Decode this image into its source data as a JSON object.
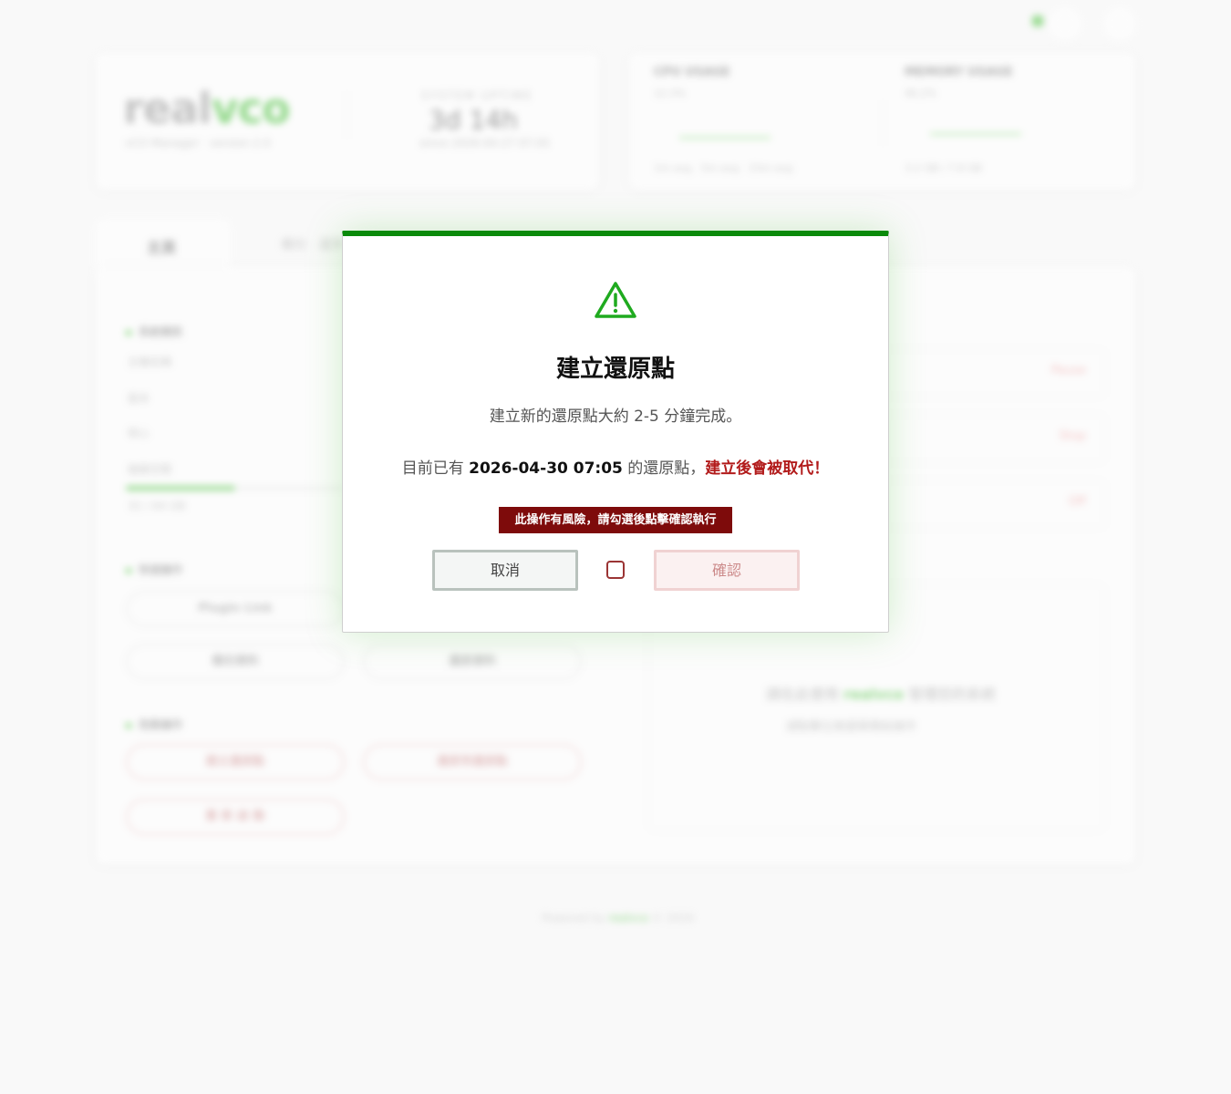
{
  "background": {
    "logo_part1": "real",
    "logo_part2": "vco",
    "logo_subtitle": "vCO Manager · version 2.0",
    "uptime_label": "SYSTEM UPTIME",
    "uptime_value": "3d 14h",
    "uptime_sub": "since 2026-04-27 07:05",
    "stat1_title": "CPU USAGE",
    "stat1_sub": "12.3%",
    "stat1_foot": "1m avg · 5m avg · 15m avg",
    "stat2_title": "MEMORY USAGE",
    "stat2_sub": "46.2%",
    "stat2_foot": "3.2 GB / 7.8 GB",
    "tab_active": "主頁",
    "tab_other": "備份 · 還原",
    "section1": "系統資訊",
    "kv1": "主機名稱",
    "kv2": "版本",
    "kv3": "核心",
    "kv4": "磁碟空間",
    "kv5": "32 / 64 GB",
    "section2": "快速操作",
    "pill1": "Plugin Link",
    "pill2": "備份資料",
    "pill3": "還原資料",
    "section3": "危險操作",
    "pill4": "建立還原點",
    "pill5": "還原到還原點",
    "pill6": "重 新 啟 動",
    "row1": "Pause",
    "row2": "Stop",
    "row3": "Off",
    "inner_text_pre": "請在此使用",
    "inner_text_brand": "realvco",
    "inner_text_post": "管理您的系統",
    "inner_sub": "請點擊左側選單開始操作",
    "footer_pre": "Powered by",
    "footer_brand": "realvco",
    "footer_post": "© 2026"
  },
  "modal": {
    "icon": "warning-triangle-icon",
    "title": "建立還原點",
    "description": "建立新的還原點大約 2-5 分鐘完成。",
    "existing_prefix": "目前已有",
    "existing_date": "2026-04-30 07:05",
    "existing_suffix": "的還原點，",
    "existing_warning": "建立後會被取代！",
    "risk_notice": "此操作有風險，請勾選後點擊確認執行",
    "cancel_label": "取消",
    "confirm_label": "確認",
    "confirm_checked": false
  },
  "colors": {
    "accent": "#0a8a0a",
    "brand_green": "#48c23a",
    "danger": "#b21b1b",
    "risk_bg": "#7e0b0b"
  }
}
